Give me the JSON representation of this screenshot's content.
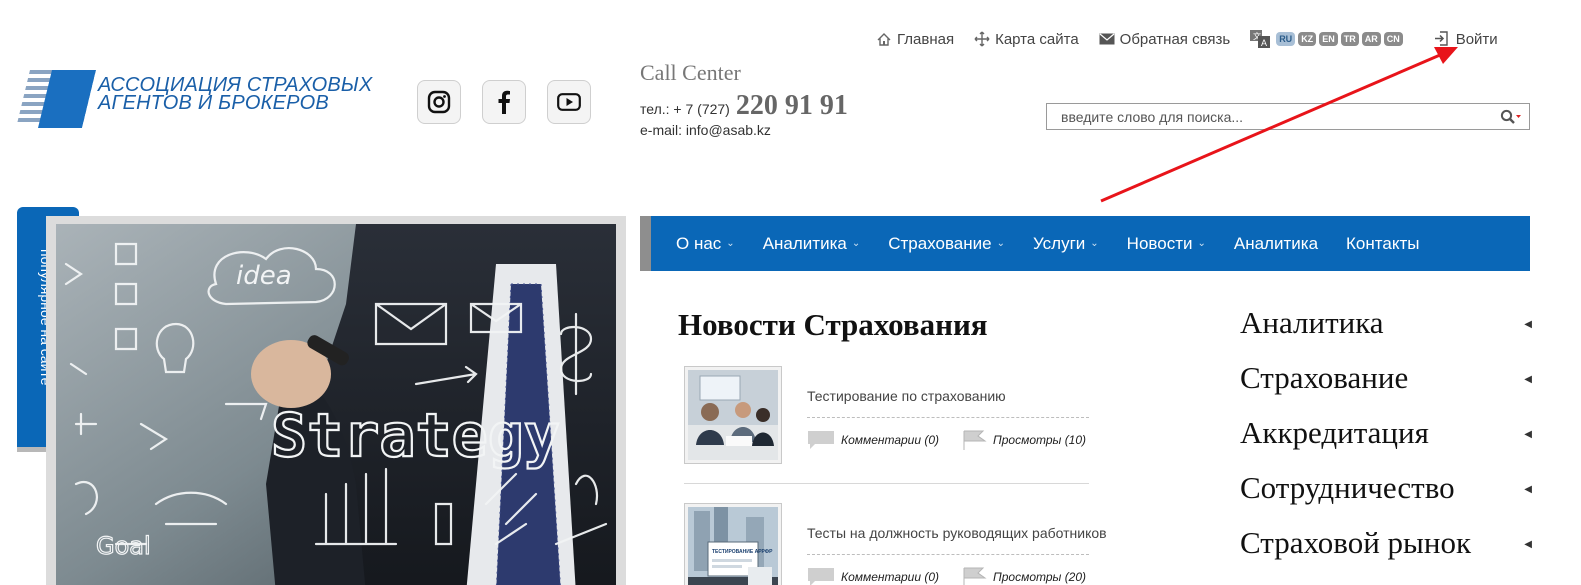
{
  "toplinks": {
    "home": "Главная",
    "sitemap": "Карта сайта",
    "feedback": "Обратная связь",
    "languages": [
      "RU",
      "KZ",
      "EN",
      "TR",
      "AR",
      "CN"
    ],
    "active_language": "RU",
    "login": "Войти"
  },
  "logo": {
    "line1": "АССОЦИАЦИЯ СТРАХОВЫХ",
    "line2": "АГЕНТОВ И БРОКЕРОВ"
  },
  "social": [
    "instagram-icon",
    "facebook-icon",
    "youtube-icon"
  ],
  "callcenter": {
    "title": "Call Center",
    "phone_prefix": "тел.: + 7 (727)",
    "phone_number": "220 91 91",
    "email": "e-mail: info@asab.kz"
  },
  "search": {
    "placeholder": "введите слово для поиска..."
  },
  "popular": {
    "label": "популярное на сайте"
  },
  "hero": {
    "word": "Strategy",
    "idea": "idea",
    "goal": "Goal"
  },
  "nav": {
    "items": [
      {
        "label": "О нас",
        "dropdown": "⌄"
      },
      {
        "label": "Аналитика",
        "dropdown": "⌄"
      },
      {
        "label": "Страхование",
        "dropdown": "⌄"
      },
      {
        "label": "Услуги",
        "dropdown": "⌄"
      },
      {
        "label": "Новости",
        "dropdown": "⌄"
      },
      {
        "label": "Аналитика",
        "dropdown": ""
      },
      {
        "label": "Контакты",
        "dropdown": ""
      }
    ]
  },
  "news": {
    "title": "Новости Страхования",
    "items": [
      {
        "title": "Тестирование по страхованию",
        "comments": "Комментарии (0)",
        "views": "Просмотры (10)"
      },
      {
        "title": "Тесты на должность руководящих работников",
        "comments": "Комментарии (0)",
        "views": "Просмотры (20)",
        "thumb_text": "ТЕСТИРОВАНИЕ АРРФР"
      }
    ]
  },
  "side": {
    "items": [
      "Аналитика",
      "Страхование",
      "Аккредитация",
      "Сотрудничество",
      "Страховой рынок"
    ]
  },
  "colors": {
    "brand_blue": "#0a67b7",
    "annotation_red": "#e8141a"
  }
}
